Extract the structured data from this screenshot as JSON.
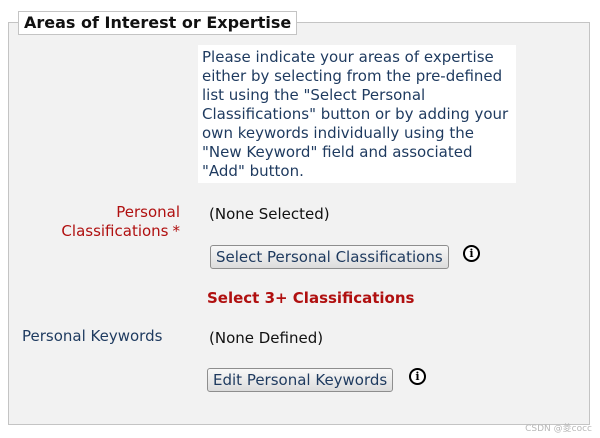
{
  "section": {
    "title": "Areas of Interest or Expertise",
    "instructions": "Please indicate your areas of expertise either by selecting from the pre-defined list using the \"Select Personal Classifications\" button or by adding your own keywords individually using the \"New Keyword\" field and associated \"Add\" button."
  },
  "personal_classifications": {
    "label": "Personal Classifications",
    "required_marker": "*",
    "value": "(None Selected)",
    "button_label": "Select Personal Classifications",
    "info_icon": "i",
    "warning": "Select 3+ Classifications"
  },
  "personal_keywords": {
    "label": "Personal Keywords",
    "value": "(None Defined)",
    "button_label": "Edit Personal Keywords",
    "info_icon": "i"
  },
  "watermark": "CSDN @菱cocc",
  "colors": {
    "panel_bg": "#f2f2f2",
    "label_text": "#1e3a5f",
    "required_red": "#b01010"
  }
}
